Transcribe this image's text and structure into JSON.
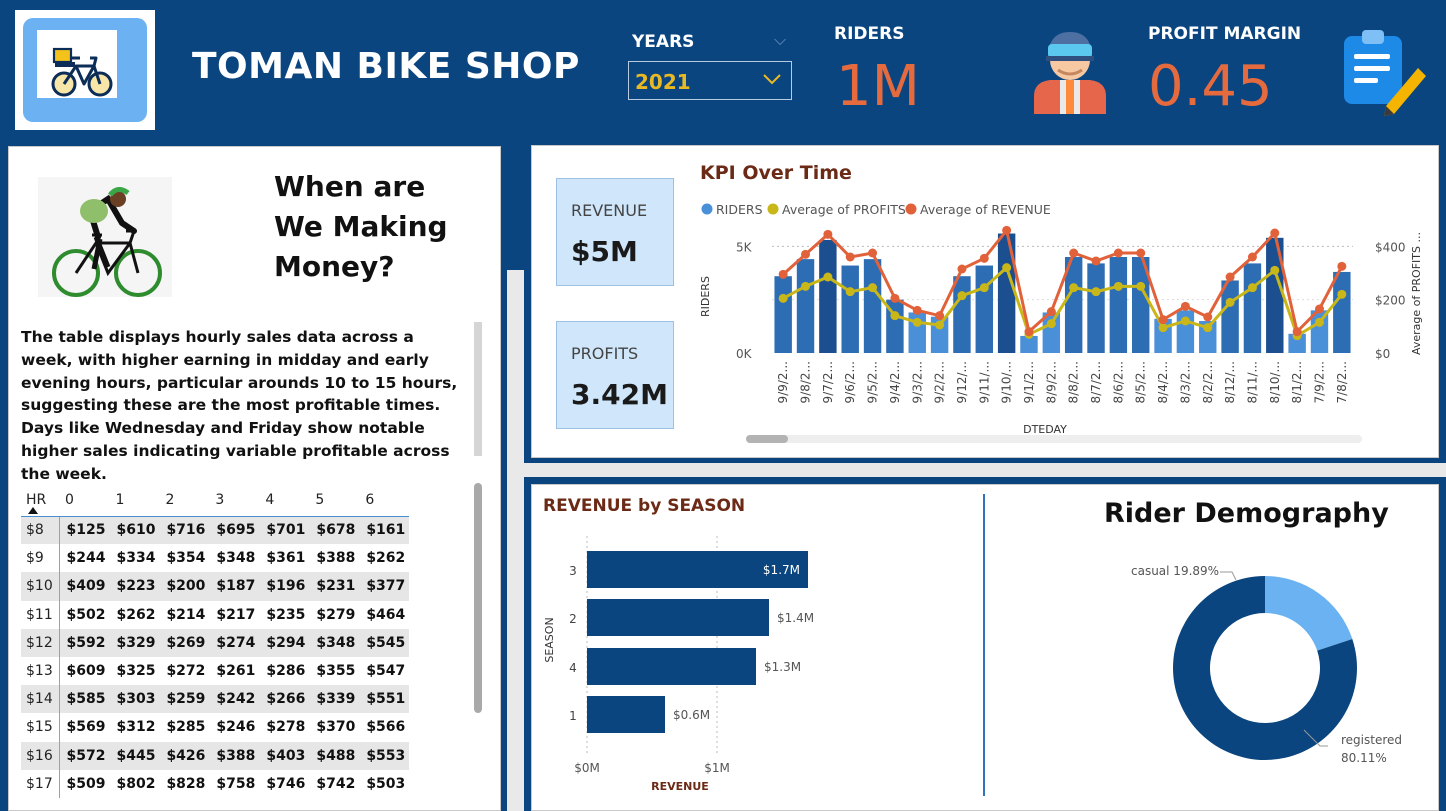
{
  "header": {
    "brand": "TOMAN BIKE SHOP",
    "years_label": "YEARS",
    "years_value": "2021",
    "riders_label": "RIDERS",
    "riders_value": "1M",
    "profit_margin_label": "PROFIT MARGIN",
    "profit_margin_value": "0.45",
    "icons": [
      "bike-logo-icon",
      "rider-avatar-icon",
      "clipboard-pencil-icon"
    ],
    "colors": {
      "header_bg": "#0b4580",
      "kpi_accent": "#e56b3f",
      "year_accent": "#e8b923"
    }
  },
  "left": {
    "hero_title_lines": [
      "When are",
      "We Making",
      "Money?"
    ],
    "description": "The table displays hourly sales data across a week, with higher earning in midday and early evening hours, particular arounds 10 to 15 hours, suggesting these are the most profitable times. Days like Wednesday and Friday show notable higher sales indicating variable profitable across the week.",
    "table": {
      "corner": "HR",
      "columns": [
        "0",
        "1",
        "2",
        "3",
        "4",
        "5",
        "6"
      ],
      "rows": [
        {
          "hr": "$8",
          "cells": [
            "$125",
            "$610",
            "$716",
            "$695",
            "$701",
            "$678",
            "$161"
          ]
        },
        {
          "hr": "$9",
          "cells": [
            "$244",
            "$334",
            "$354",
            "$348",
            "$361",
            "$388",
            "$262"
          ]
        },
        {
          "hr": "$10",
          "cells": [
            "$409",
            "$223",
            "$200",
            "$187",
            "$196",
            "$231",
            "$377"
          ]
        },
        {
          "hr": "$11",
          "cells": [
            "$502",
            "$262",
            "$214",
            "$217",
            "$235",
            "$279",
            "$464"
          ]
        },
        {
          "hr": "$12",
          "cells": [
            "$592",
            "$329",
            "$269",
            "$274",
            "$294",
            "$348",
            "$545"
          ]
        },
        {
          "hr": "$13",
          "cells": [
            "$609",
            "$325",
            "$272",
            "$261",
            "$286",
            "$355",
            "$547"
          ]
        },
        {
          "hr": "$14",
          "cells": [
            "$585",
            "$303",
            "$259",
            "$242",
            "$266",
            "$339",
            "$551"
          ]
        },
        {
          "hr": "$15",
          "cells": [
            "$569",
            "$312",
            "$285",
            "$246",
            "$278",
            "$370",
            "$566"
          ]
        },
        {
          "hr": "$16",
          "cells": [
            "$572",
            "$445",
            "$426",
            "$388",
            "$403",
            "$488",
            "$553"
          ]
        },
        {
          "hr": "$17",
          "cells": [
            "$509",
            "$802",
            "$828",
            "$758",
            "$746",
            "$742",
            "$503"
          ]
        }
      ]
    }
  },
  "cards": {
    "revenue_label": "REVENUE",
    "revenue_value": "$5M",
    "profits_label": "PROFITS",
    "profits_value": "3.42M"
  },
  "chart_data": [
    {
      "type": "bar",
      "title": "KPI Over Time",
      "xlabel": "DTEDAY",
      "ylabel": "RIDERS",
      "y2label": "Average of PROFITS ...",
      "legend": [
        "RIDERS",
        "Average of PROFITS",
        "Average of REVENUE"
      ],
      "legend_position": "top-left",
      "ylim": [
        0,
        6000
      ],
      "y2lim": [
        0,
        480
      ],
      "y_ticks": [
        "5K",
        "0K"
      ],
      "y2_ticks": [
        "$400",
        "$200",
        "$0"
      ],
      "categories": [
        "9/9/2...",
        "9/8/2...",
        "9/7/2...",
        "9/6/2...",
        "9/5/2...",
        "9/4/2...",
        "9/3/2...",
        "9/2/2...",
        "9/12/...",
        "9/11/...",
        "9/10/...",
        "9/1/2...",
        "8/9/2...",
        "8/8/2...",
        "8/7/2...",
        "8/6/2...",
        "8/5/2...",
        "8/4/2...",
        "8/3/2...",
        "8/2/2...",
        "8/12/...",
        "8/11/...",
        "8/10/...",
        "8/1/2...",
        "7/9/2...",
        "7/8/2..."
      ],
      "series": [
        {
          "name": "RIDERS",
          "type": "bar",
          "values": [
            3600,
            4400,
            5300,
            4100,
            4400,
            2500,
            1900,
            1700,
            3600,
            4100,
            5600,
            800,
            1900,
            4500,
            4200,
            4500,
            4500,
            1600,
            2000,
            1500,
            3400,
            4200,
            5400,
            900,
            2000,
            3800
          ]
        },
        {
          "name": "Average of PROFITS",
          "type": "line",
          "values": [
            205,
            250,
            285,
            230,
            245,
            140,
            115,
            105,
            215,
            245,
            320,
            70,
            110,
            245,
            230,
            250,
            250,
            95,
            120,
            95,
            190,
            245,
            310,
            65,
            115,
            220
          ]
        },
        {
          "name": "Average of REVENUE",
          "type": "line",
          "values": [
            295,
            370,
            445,
            360,
            375,
            205,
            160,
            140,
            315,
            355,
            460,
            80,
            155,
            375,
            345,
            375,
            375,
            125,
            175,
            135,
            285,
            360,
            450,
            80,
            165,
            325
          ]
        }
      ],
      "colors": {
        "bar": "#2d6db3",
        "bar_dark": "#1b4f8f",
        "bar_light": "#4a90d9",
        "profits": "#c9b71a",
        "revenue": "#e1623a"
      }
    },
    {
      "type": "bar",
      "orientation": "horizontal",
      "title": "REVENUE by SEASON",
      "xlabel": "REVENUE",
      "ylabel": "SEASON",
      "categories": [
        "3",
        "2",
        "4",
        "1"
      ],
      "values": [
        1.7,
        1.4,
        1.3,
        0.6
      ],
      "labels": [
        "$1.7M",
        "$1.4M",
        "$1.3M",
        "$0.6M"
      ],
      "x_ticks": [
        "$0M",
        "$1M"
      ],
      "xlim": [
        0,
        1.7
      ],
      "color": "#0b4580"
    },
    {
      "type": "pie",
      "donut": true,
      "title": "Rider Demography",
      "slices": [
        {
          "name": "casual",
          "percent": 19.89,
          "label": "casual 19.89%",
          "color": "#6ab2f2"
        },
        {
          "name": "registered",
          "percent": 80.11,
          "label_line1": "registered",
          "label_line2": "80.11%",
          "color": "#0b4580"
        }
      ]
    }
  ]
}
